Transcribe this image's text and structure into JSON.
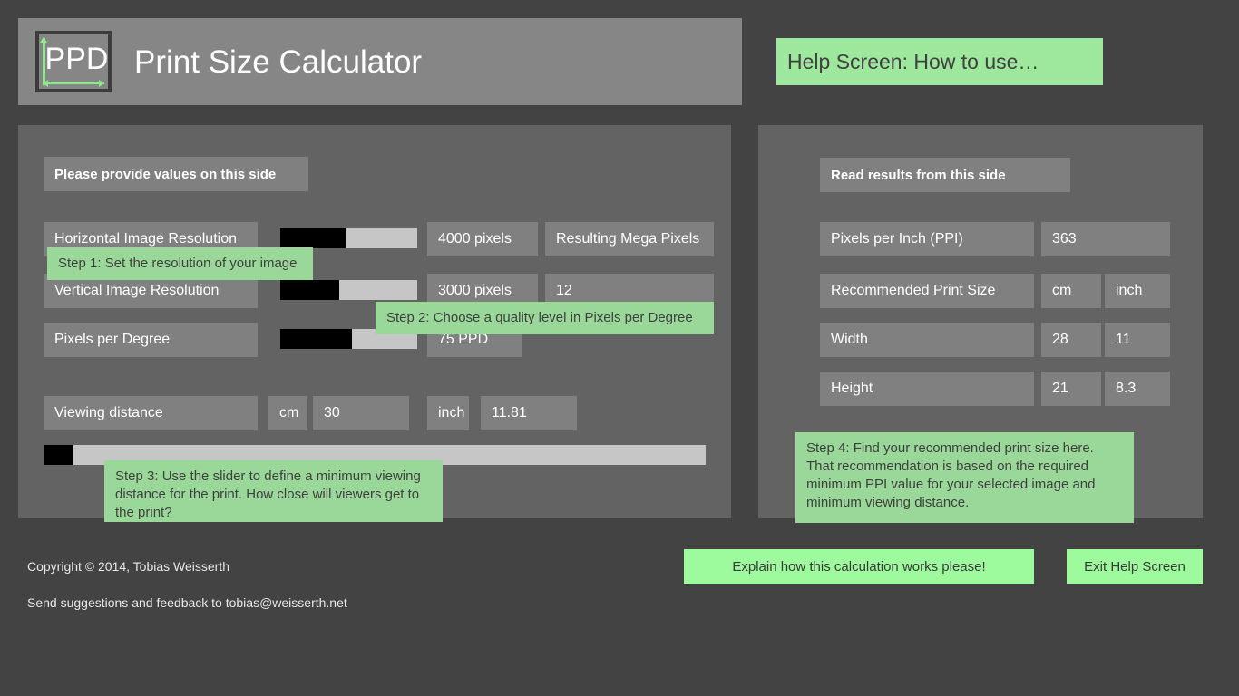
{
  "app": {
    "logo_text": "PPD",
    "title": "Print Size Calculator"
  },
  "help": {
    "header": "Help Screen: How to use…"
  },
  "left_panel": {
    "section_title": "Please provide values on this side",
    "rows": [
      {
        "label": "Horizontal Image Resolution",
        "value": "4000 pixels",
        "slider_percent": 48
      },
      {
        "label": "Vertical Image Resolution",
        "value": "3000 pixels",
        "slider_percent": 43
      },
      {
        "label": "Pixels per Degree",
        "value": "75 PPD",
        "slider_percent": 52
      }
    ],
    "megapixels": {
      "label": "Resulting Mega Pixels",
      "value": "12"
    },
    "viewing_distance": {
      "label": "Viewing distance",
      "cm_unit": "cm",
      "cm_value": "30",
      "inch_unit": "inch",
      "inch_value": "11.81",
      "slider_percent": 4
    }
  },
  "right_panel": {
    "section_title": "Read results from this side",
    "ppi": {
      "label": "Pixels per Inch (PPI)",
      "value": "363"
    },
    "print_size": {
      "label": "Recommended Print Size",
      "cm_unit": "cm",
      "inch_unit": "inch"
    },
    "width": {
      "label": "Width",
      "cm": "28",
      "inch": "11"
    },
    "height": {
      "label": "Height",
      "cm": "21",
      "inch": "8.3"
    }
  },
  "tooltips": {
    "step1": "Step 1: Set the resolution of your image",
    "step2": "Step 2: Choose a quality level in Pixels per Degree",
    "step3": "Step 3: Use the slider to define a minimum viewing distance for the print. How close will viewers get to the print?",
    "step4": "Step 4: Find your recommended print size here. That recommendation is based on the required minimum PPI value for your selected image and minimum viewing distance."
  },
  "footer": {
    "copyright": "Copyright © 2014, Tobias Weisserth",
    "feedback": "Send suggestions and feedback to tobias@weisserth.net",
    "explain_button": "Explain how this calculation works please!",
    "exit_button": "Exit Help Screen"
  },
  "colors": {
    "page_background": "#434343",
    "panel": "#636363",
    "field": "#808080",
    "header_bar": "#868686",
    "accent_green": "#9ee89e",
    "tooltip_green": "#9ad89a",
    "button_green": "#9dfb9d",
    "slider_track": "#c6c6c6",
    "slider_fill": "#000000"
  }
}
